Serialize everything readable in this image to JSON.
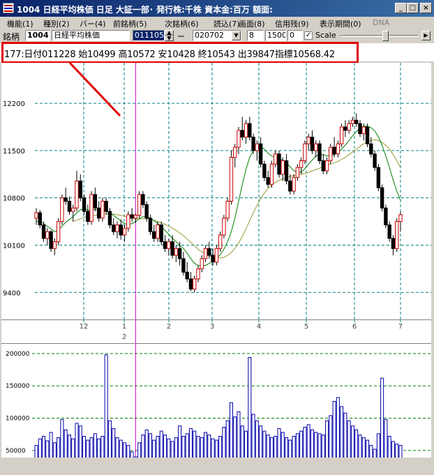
{
  "window": {
    "title": "1004 日経平均株価 日足 大証一部･ 発行株:千株 資本金:百万 額面:",
    "buttons": [
      "_",
      "□",
      "×"
    ]
  },
  "menu": [
    {
      "label": "機能(1)"
    },
    {
      "label": "種別(2)"
    },
    {
      "label": "バー(4)"
    },
    {
      "label": "前銘柄(5)"
    },
    {
      "label": "次銘柄(6)"
    },
    {
      "label": "読込(7)"
    },
    {
      "label": "画面(8)"
    },
    {
      "label": "信用残(9)"
    },
    {
      "label": "表示期間(0)"
    },
    {
      "label": "DNA"
    }
  ],
  "toolbar": {
    "symbol_label": "銘柄",
    "code": "1004",
    "name": "日経平均株価",
    "date_from": "011105",
    "separator": "ー",
    "date_to": "020702",
    "field_a": "8",
    "field_b": "1500",
    "field_c": "0",
    "scale_label": "Scale"
  },
  "info": {
    "text": "177:日付011228 始10499 高10572 安10428 終10543 出39847指標10568.42"
  },
  "colors": {
    "highlight": "#e00000",
    "up_candle": "#cc0000",
    "down_candle": "#000000",
    "ma_short": "#008000",
    "ma_long": "#999933",
    "grid": "#008080",
    "cursor": "#cc00cc",
    "volume": "#0000aa"
  },
  "chart_data": {
    "type": "candlestick",
    "x_month_labels": [
      "12",
      "1",
      "2",
      "3",
      "4",
      "5",
      "6",
      "7"
    ],
    "year_label": "2",
    "price_ticks": [
      12200,
      11500,
      10800,
      10100,
      9400
    ],
    "volume_ticks": [
      200000,
      150000,
      100000,
      50000
    ],
    "ylim": [
      9000,
      12800
    ],
    "volume_ylim": [
      38000,
      215000
    ],
    "cursor_index": 27,
    "candles": [
      [
        10500,
        10650,
        10400,
        10580
      ],
      [
        10580,
        10620,
        10350,
        10400
      ],
      [
        10400,
        10450,
        10150,
        10200
      ],
      [
        10200,
        10350,
        10100,
        10300
      ],
      [
        10300,
        10320,
        10000,
        10050
      ],
      [
        10050,
        10200,
        9950,
        10150
      ],
      [
        10150,
        10500,
        10100,
        10450
      ],
      [
        10450,
        10850,
        10400,
        10800
      ],
      [
        10800,
        10950,
        10700,
        10750
      ],
      [
        10750,
        10820,
        10550,
        10600
      ],
      [
        10600,
        10700,
        10450,
        10650
      ],
      [
        10650,
        11200,
        10600,
        11050
      ],
      [
        11050,
        11150,
        10750,
        10800
      ],
      [
        10800,
        10850,
        10550,
        10600
      ],
      [
        10600,
        10700,
        10400,
        10450
      ],
      [
        10450,
        10900,
        10400,
        10850
      ],
      [
        10850,
        10950,
        10600,
        10650
      ],
      [
        10650,
        10750,
        10450,
        10500
      ],
      [
        10500,
        10800,
        10450,
        10750
      ],
      [
        10750,
        10800,
        10550,
        10600
      ],
      [
        10600,
        10650,
        10350,
        10400
      ],
      [
        10400,
        10500,
        10250,
        10300
      ],
      [
        10300,
        10450,
        10200,
        10400
      ],
      [
        10400,
        10480,
        10180,
        10250
      ],
      [
        10250,
        10400,
        10150,
        10350
      ],
      [
        10350,
        10600,
        10300,
        10550
      ],
      [
        10550,
        10650,
        10450,
        10500
      ],
      [
        10499,
        10572,
        10428,
        10543
      ],
      [
        10543,
        10900,
        10500,
        10850
      ],
      [
        10850,
        10900,
        10650,
        10700
      ],
      [
        10700,
        10750,
        10450,
        10500
      ],
      [
        10500,
        10550,
        10250,
        10300
      ],
      [
        10300,
        10400,
        10150,
        10200
      ],
      [
        10200,
        10450,
        10150,
        10400
      ],
      [
        10400,
        10450,
        10100,
        10150
      ],
      [
        10150,
        10250,
        10000,
        10050
      ],
      [
        10050,
        10200,
        9950,
        10150
      ],
      [
        10150,
        10250,
        9900,
        9950
      ],
      [
        9950,
        10100,
        9850,
        10050
      ],
      [
        10050,
        10150,
        9800,
        9900
      ],
      [
        9900,
        10000,
        9650,
        9700
      ],
      [
        9700,
        9850,
        9550,
        9600
      ],
      [
        9600,
        9700,
        9420,
        9450
      ],
      [
        9450,
        9650,
        9400,
        9600
      ],
      [
        9600,
        9800,
        9550,
        9750
      ],
      [
        9750,
        9950,
        9700,
        9900
      ],
      [
        9900,
        10100,
        9850,
        10050
      ],
      [
        10050,
        10150,
        9900,
        9950
      ],
      [
        9950,
        10050,
        9800,
        9850
      ],
      [
        9850,
        10100,
        9800,
        10050
      ],
      [
        10050,
        10300,
        10000,
        10250
      ],
      [
        10250,
        10550,
        10200,
        10500
      ],
      [
        10500,
        10800,
        10450,
        10750
      ],
      [
        10750,
        11500,
        10700,
        11400
      ],
      [
        11400,
        11600,
        11250,
        11550
      ],
      [
        11550,
        11850,
        11450,
        11800
      ],
      [
        11800,
        12000,
        11650,
        11700
      ],
      [
        11700,
        11950,
        11600,
        11900
      ],
      [
        11900,
        12000,
        11650,
        11700
      ],
      [
        11700,
        11750,
        11450,
        11500
      ],
      [
        11500,
        11650,
        11350,
        11600
      ],
      [
        11600,
        11700,
        11250,
        11300
      ],
      [
        11300,
        11350,
        11050,
        11100
      ],
      [
        11100,
        11200,
        10950,
        11000
      ],
      [
        11000,
        11350,
        10950,
        11300
      ],
      [
        11300,
        11500,
        11250,
        11450
      ],
      [
        11450,
        11500,
        11100,
        11150
      ],
      [
        11150,
        11400,
        11050,
        11350
      ],
      [
        11350,
        11450,
        11000,
        11050
      ],
      [
        11050,
        11150,
        10850,
        10900
      ],
      [
        10900,
        11150,
        10850,
        11100
      ],
      [
        11100,
        11300,
        11050,
        11250
      ],
      [
        11250,
        11400,
        11150,
        11350
      ],
      [
        11350,
        11650,
        11300,
        11600
      ],
      [
        11600,
        11750,
        11500,
        11700
      ],
      [
        11700,
        11800,
        11450,
        11500
      ],
      [
        11500,
        11650,
        11400,
        11600
      ],
      [
        11600,
        11650,
        11300,
        11350
      ],
      [
        11350,
        11450,
        11150,
        11200
      ],
      [
        11200,
        11400,
        11150,
        11350
      ],
      [
        11350,
        11600,
        11300,
        11550
      ],
      [
        11550,
        11700,
        11400,
        11450
      ],
      [
        11450,
        11650,
        11400,
        11600
      ],
      [
        11600,
        11900,
        11550,
        11850
      ],
      [
        11850,
        11950,
        11700,
        11800
      ],
      [
        11800,
        11950,
        11750,
        11900
      ],
      [
        11900,
        12000,
        11850,
        11950
      ],
      [
        11950,
        12050,
        11850,
        11900
      ],
      [
        11900,
        11950,
        11700,
        11750
      ],
      [
        11750,
        11900,
        11650,
        11850
      ],
      [
        11850,
        11900,
        11550,
        11600
      ],
      [
        11600,
        11700,
        11400,
        11450
      ],
      [
        11450,
        11500,
        11200,
        11250
      ],
      [
        11250,
        11300,
        10900,
        10950
      ],
      [
        10950,
        11000,
        10600,
        10650
      ],
      [
        10650,
        10700,
        10350,
        10400
      ],
      [
        10400,
        10450,
        10150,
        10200
      ],
      [
        10200,
        10250,
        9950,
        10050
      ],
      [
        10050,
        10500,
        10000,
        10450
      ],
      [
        10450,
        10600,
        10300,
        10550
      ]
    ],
    "ma_short": [
      10450,
      10460,
      10420,
      10380,
      10340,
      10300,
      10320,
      10380,
      10440,
      10480,
      10520,
      10580,
      10620,
      10640,
      10620,
      10620,
      10630,
      10620,
      10600,
      10600,
      10580,
      10540,
      10500,
      10460,
      10420,
      10400,
      10420,
      10450,
      10490,
      10520,
      10520,
      10500,
      10460,
      10420,
      10380,
      10320,
      10260,
      10200,
      10150,
      10100,
      10050,
      9980,
      9900,
      9830,
      9800,
      9790,
      9800,
      9830,
      9860,
      9900,
      9960,
      10040,
      10150,
      10300,
      10500,
      10750,
      11000,
      11220,
      11400,
      11500,
      11550,
      11560,
      11520,
      11460,
      11420,
      11400,
      11380,
      11360,
      11320,
      11260,
      11200,
      11180,
      11180,
      11230,
      11300,
      11360,
      11420,
      11440,
      11440,
      11420,
      11420,
      11440,
      11470,
      11520,
      11580,
      11650,
      11720,
      11780,
      11830,
      11860,
      11860,
      11840,
      11790,
      11700,
      11580,
      11420,
      11250,
      11060,
      10900,
      10760
    ],
    "ma_long": [
      null,
      null,
      null,
      null,
      null,
      null,
      null,
      null,
      null,
      null,
      10450,
      10470,
      10490,
      10510,
      10520,
      10530,
      10540,
      10550,
      10560,
      10560,
      10560,
      10560,
      10550,
      10540,
      10530,
      10510,
      10500,
      10490,
      10490,
      10490,
      10490,
      10480,
      10470,
      10450,
      10430,
      10410,
      10380,
      10350,
      10320,
      10280,
      10240,
      10190,
      10140,
      10090,
      10040,
      10000,
      9970,
      9940,
      9920,
      9910,
      9910,
      9920,
      9950,
      9990,
      10050,
      10130,
      10230,
      10340,
      10460,
      10580,
      10690,
      10790,
      10870,
      10940,
      10990,
      11030,
      11060,
      11080,
      11100,
      11120,
      11130,
      11140,
      11150,
      11160,
      11180,
      11200,
      11220,
      11240,
      11260,
      11280,
      11300,
      11320,
      11340,
      11370,
      11400,
      11440,
      11480,
      11520,
      11560,
      11600,
      11630,
      11650,
      11660,
      11650,
      11620,
      11580,
      11520,
      11440,
      11350,
      11250
    ],
    "volumes": [
      58000,
      68000,
      72000,
      65000,
      78000,
      62000,
      70000,
      98000,
      82000,
      74000,
      68000,
      92000,
      88000,
      72000,
      66000,
      70000,
      76000,
      68000,
      72000,
      198000,
      96000,
      84000,
      70000,
      66000,
      62000,
      58000,
      48000,
      40000,
      62000,
      74000,
      82000,
      76000,
      66000,
      72000,
      80000,
      74000,
      68000,
      64000,
      70000,
      88000,
      72000,
      76000,
      84000,
      80000,
      72000,
      70000,
      78000,
      74000,
      68000,
      66000,
      72000,
      86000,
      96000,
      124000,
      102000,
      110000,
      88000,
      80000,
      194000,
      106000,
      96000,
      88000,
      80000,
      74000,
      70000,
      72000,
      84000,
      78000,
      70000,
      66000,
      72000,
      76000,
      80000,
      86000,
      90000,
      82000,
      78000,
      76000,
      74000,
      96000,
      104000,
      126000,
      132000,
      118000,
      108000,
      96000,
      88000,
      82000,
      74000,
      70000,
      66000,
      58000,
      52000,
      76000,
      162000,
      98000,
      72000,
      64000,
      60000,
      58000
    ]
  }
}
